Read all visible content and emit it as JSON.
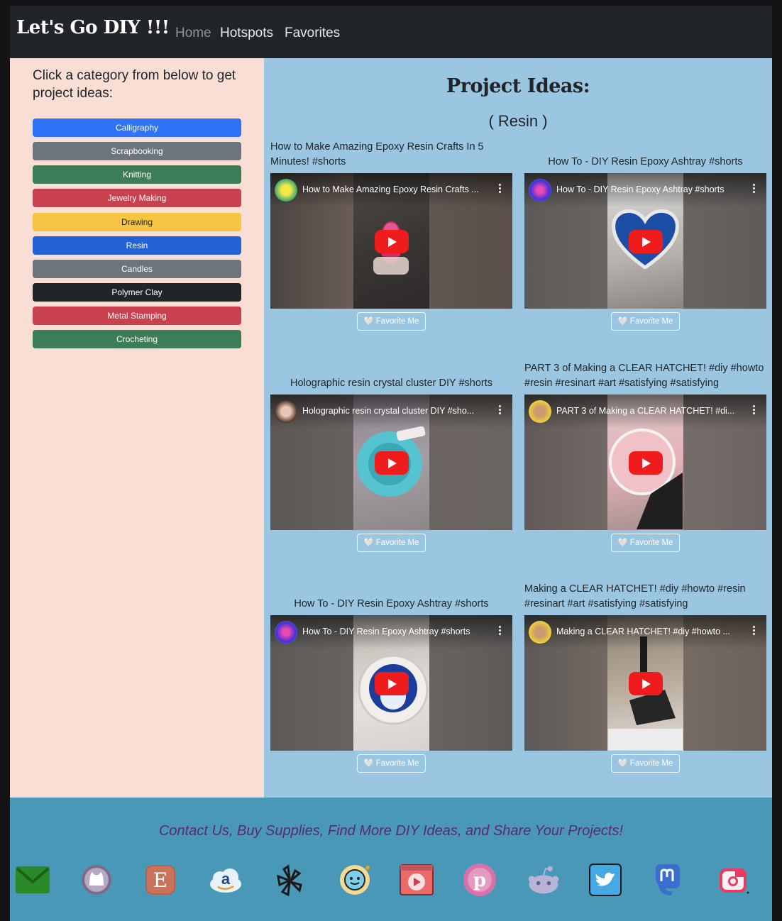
{
  "brand": "Let's Go DIY !!!",
  "nav": {
    "home": "Home",
    "hotspots": "Hotspots",
    "favorites": "Favorites"
  },
  "sidebar": {
    "title": "Click a category from below to get project ideas:",
    "categories": [
      {
        "label": "Calligraphy",
        "color": "#2f72f6"
      },
      {
        "label": "Scrapbooking",
        "color": "#6c757d"
      },
      {
        "label": "Knitting",
        "color": "#3c7d57"
      },
      {
        "label": "Jewelry Making",
        "color": "#c9414e"
      },
      {
        "label": "Drawing",
        "color": "#f5c443"
      },
      {
        "label": "Resin",
        "color": "#2463d6"
      },
      {
        "label": "Candles",
        "color": "#6c757d"
      },
      {
        "label": "Polymer Clay",
        "color": "#212529"
      },
      {
        "label": "Metal Stamping",
        "color": "#c9414e"
      },
      {
        "label": "Crocheting",
        "color": "#3c7d57"
      }
    ]
  },
  "main": {
    "title": "Project Ideas:",
    "subtitle": "( Resin )",
    "favorite_label": "Favorite Me",
    "videos": [
      {
        "title": "How to Make Amazing Epoxy Resin Crafts In 5 Minutes! #shorts",
        "overlay": "How to Make Amazing Epoxy Resin Crafts ..."
      },
      {
        "title": "How To - DIY Resin Epoxy Ashtray #shorts",
        "overlay": "How To - DIY Resin Epoxy Ashtray #shorts"
      },
      {
        "title": "Holographic resin crystal cluster DIY #shorts",
        "overlay": "Holographic resin crystal cluster DIY #sho..."
      },
      {
        "title": "PART 3 of Making a CLEAR HATCHET! #diy #howto #resin #resinart #art #satisfying #satisfying",
        "overlay": "PART 3 of Making a CLEAR HATCHET! #di..."
      },
      {
        "title": "How To - DIY Resin Epoxy Ashtray #shorts",
        "overlay": "How To - DIY Resin Epoxy Ashtray #shorts"
      },
      {
        "title": "Making a CLEAR HATCHET! #diy #howto #resin #resinart #art #satisfying #satisfying",
        "overlay": "Making a CLEAR HATCHET! #diy #howto ..."
      }
    ]
  },
  "footer": {
    "text": "Contact Us, Buy Supplies, Find More DIY Ideas, and Share Your Projects!",
    "icons": [
      "email-icon",
      "github-icon",
      "etsy-icon",
      "amazon-icon",
      "yelp-icon",
      "waze-icon",
      "youtube-icon",
      "pinterest-icon",
      "reddit-icon",
      "twitter-icon",
      "mastodon-icon",
      "instagram-icon"
    ]
  }
}
